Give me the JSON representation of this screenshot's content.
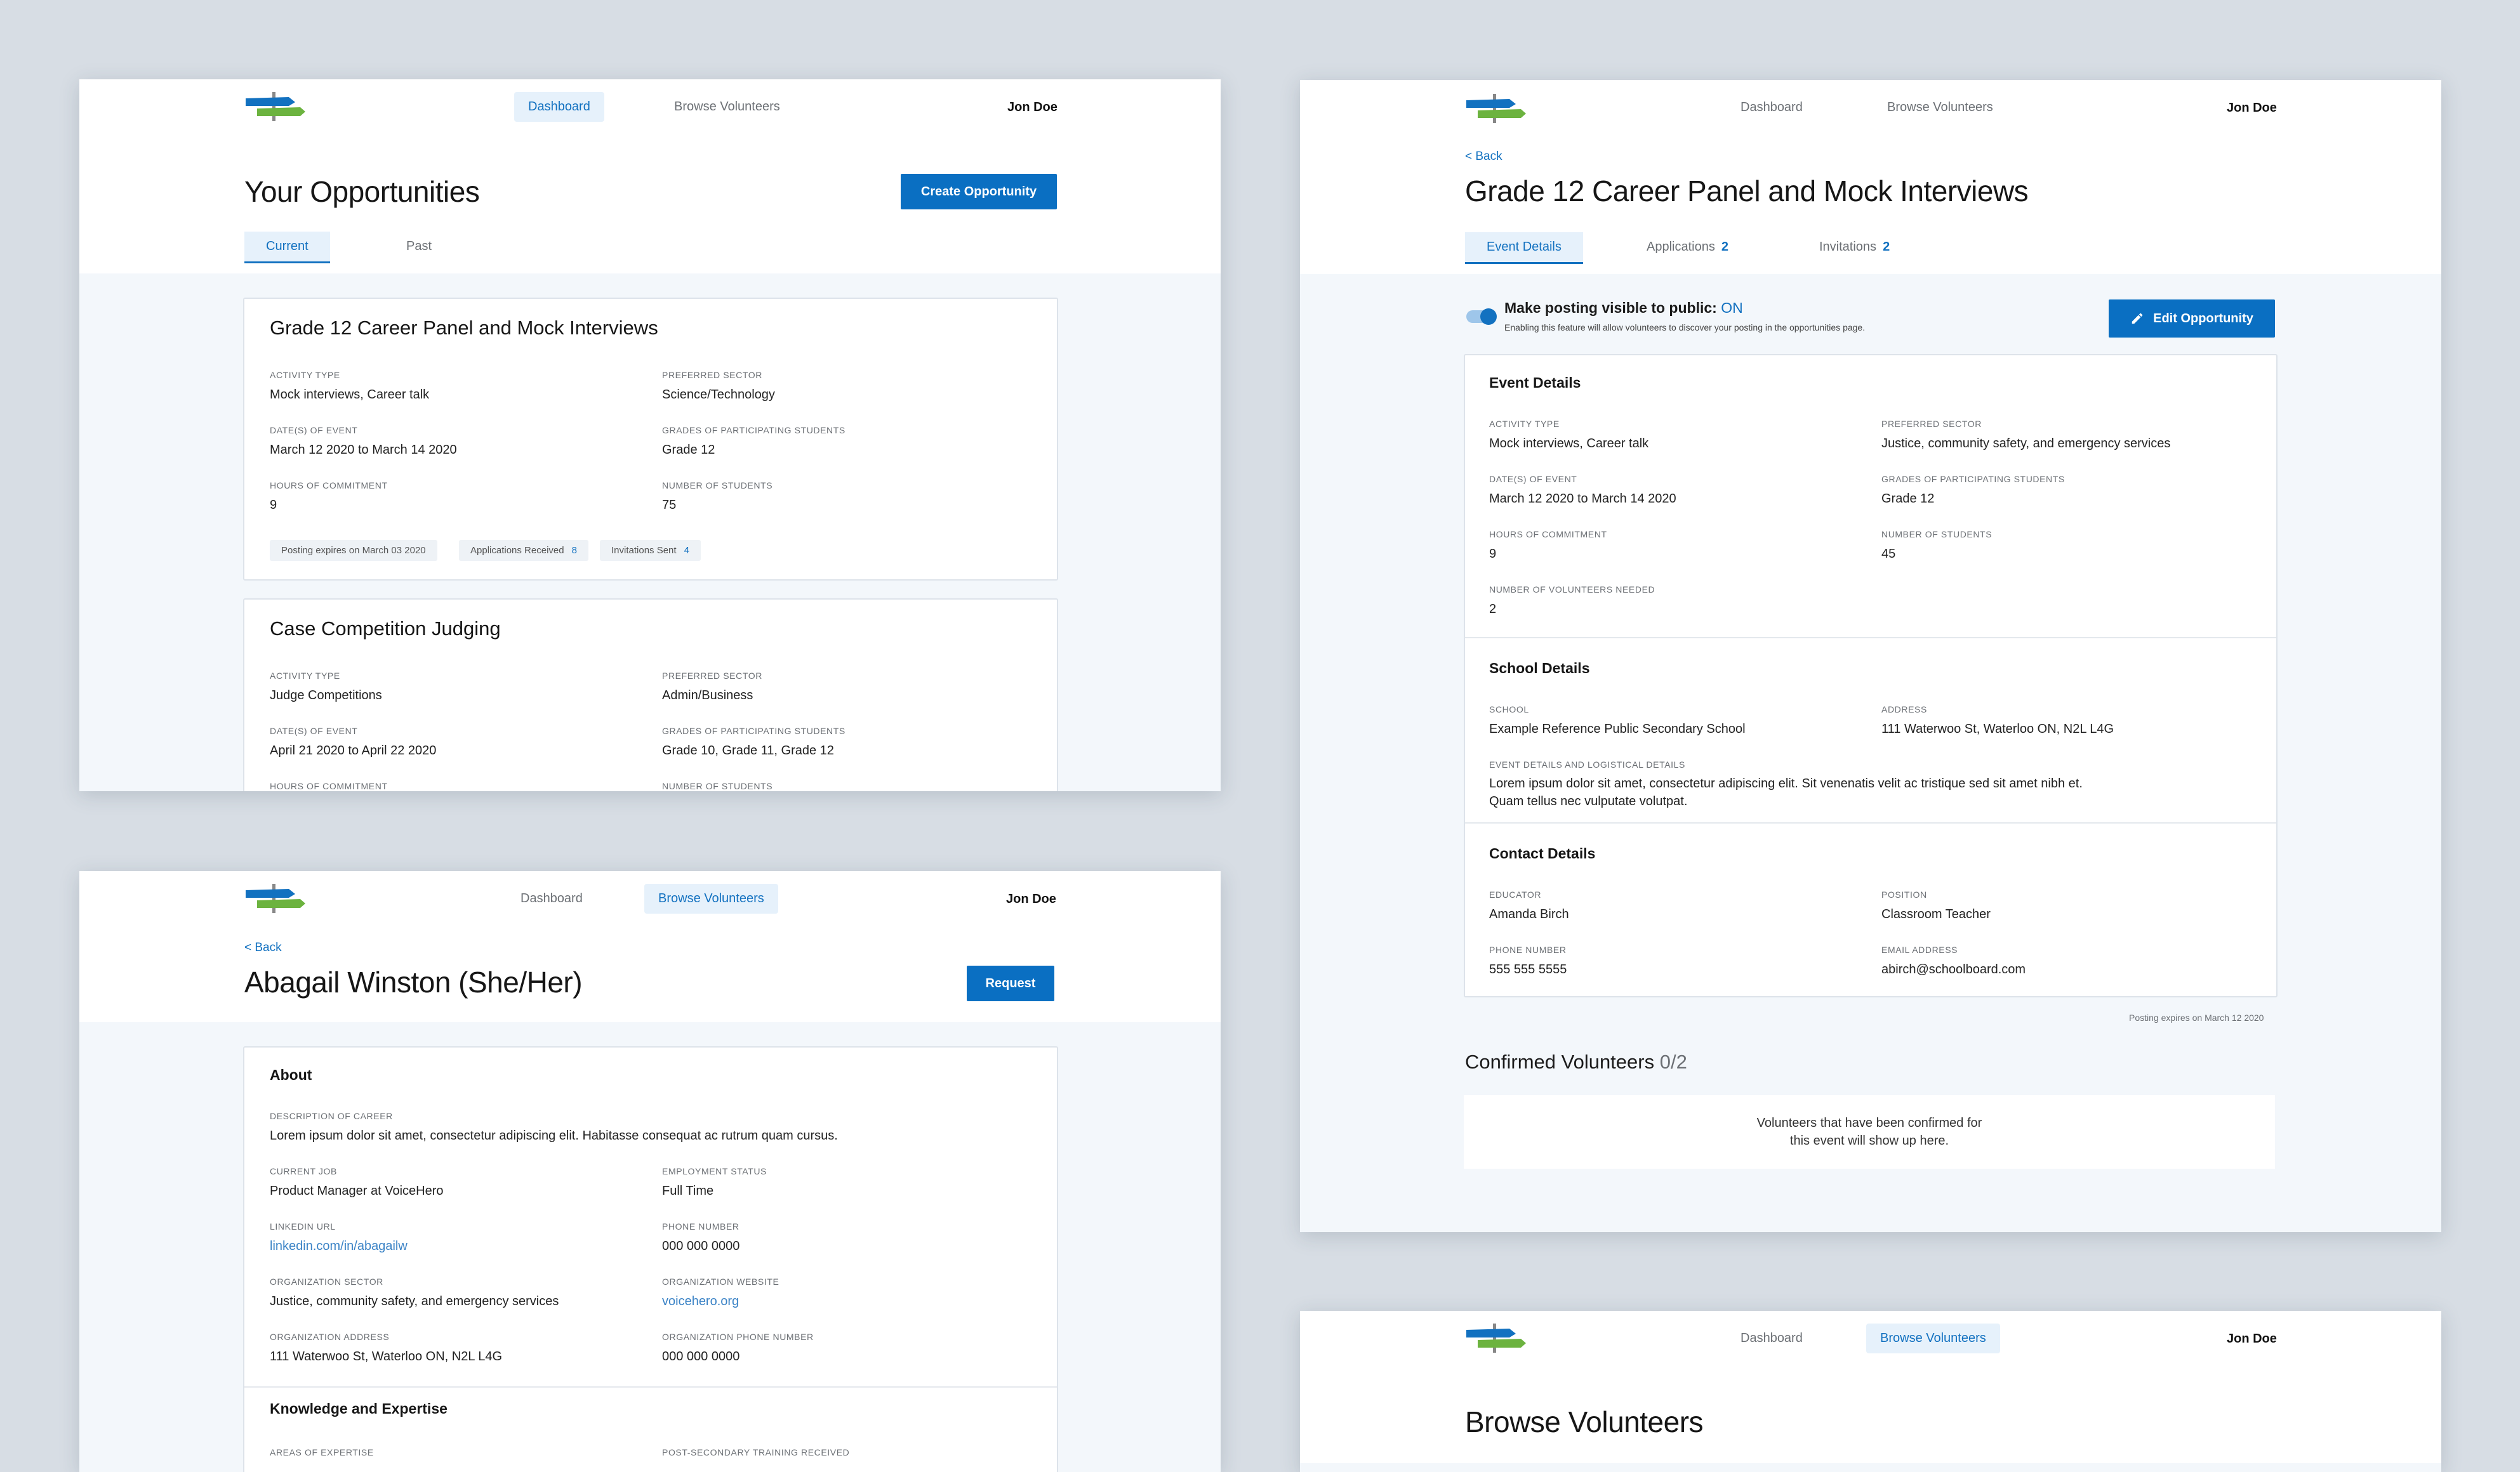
{
  "colors": {
    "brand_blue": "#0a6fc2",
    "link": "#1271c0",
    "bg": "#d7dde4",
    "panel": "#f3f7fb"
  },
  "nav": {
    "dashboard": "Dashboard",
    "browse": "Browse Volunteers",
    "user": "Jon Doe"
  },
  "s1": {
    "title": "Your Opportunities",
    "create_btn": "Create Opportunity",
    "tabs": [
      "Current",
      "Past"
    ],
    "card1": {
      "title": "Grade 12 Career Panel and Mock Interviews",
      "activity_label": "Activity Type",
      "activity": "Mock interviews, Career talk",
      "sector_label": "Preferred Sector",
      "sector": "Science/Technology",
      "dates_label": "Date(s) of Event",
      "dates": "March 12 2020 to March 14 2020",
      "grades_label": "Grades of Participating Students",
      "grades": "Grade 12",
      "hours_label": "Hours of Commitment",
      "hours": "9",
      "students_label": "Number of Students",
      "students": "75",
      "expires": "Posting expires on March 03 2020",
      "apps_label": "Applications Received",
      "apps": "8",
      "inv_label": "Invitations Sent",
      "inv": "4"
    },
    "card2": {
      "title": "Case Competition Judging",
      "activity_label": "Activity Type",
      "activity": "Judge Competitions",
      "sector_label": "Preferred Sector",
      "sector": "Admin/Business",
      "dates_label": "Date(s) of Event",
      "dates": "April 21 2020 to April 22 2020",
      "grades_label": "Grades of Participating Students",
      "grades": "Grade 10, Grade 11, Grade 12",
      "hours_label": "Hours of Commitment",
      "students_label": "Number of Students"
    }
  },
  "s2": {
    "back": "< Back",
    "title": "Abagail Winston (She/Her)",
    "request_btn": "Request",
    "about": "About",
    "career_label": "Description of Career",
    "career": "Lorem ipsum dolor sit amet, consectetur adipiscing elit. Habitasse consequat ac rutrum quam cursus.",
    "job_label": "Current Job",
    "job": "Product Manager at VoiceHero",
    "emp_label": "Employment Status",
    "emp": "Full Time",
    "linkedin_label": "LinkedIn URL",
    "linkedin": "linkedin.com/in/abagailw",
    "phone_label": "Phone Number",
    "phone": "000 000 0000",
    "org_sector_label": "Organization Sector",
    "org_sector": "Justice, community safety, and emergency services",
    "org_web_label": "Organization Website",
    "org_web": "voicehero.org",
    "org_addr_label": "Organization Address",
    "org_addr": "111 Waterwoo St, Waterloo ON, N2L L4G",
    "org_phone_label": "Organization Phone Number",
    "org_phone": "000 000 0000",
    "knowledge": "Knowledge and Expertise",
    "areas_label": "Areas of Expertise",
    "training_label": "Post-Secondary Training Received"
  },
  "s3": {
    "back": "< Back",
    "title": "Grade 12 Career Panel and Mock Interviews",
    "tabs": {
      "event": "Event Details",
      "apps": "Applications",
      "apps_n": "2",
      "inv": "Invitations",
      "inv_n": "2"
    },
    "toggle_label": "Make posting visible to public:",
    "toggle_state": "ON",
    "toggle_help": "Enabling this feature will allow volunteers to discover your posting in the opportunities page.",
    "edit_btn": "Edit Opportunity",
    "event_details": "Event Details",
    "activity_label": "Activity Type",
    "activity": "Mock interviews, Career talk",
    "sector_label": "Preferred Sector",
    "sector": "Justice, community safety, and emergency services",
    "dates_label": "Date(s) of Event",
    "dates": "March 12 2020 to March 14 2020",
    "grades_label": "Grades of Participating Students",
    "grades": "Grade 12",
    "hours_label": "Hours of Commitment",
    "hours": "9",
    "students_label": "Number of Students",
    "students": "45",
    "vol_needed_label": "Number of Volunteers Needed",
    "vol_needed": "2",
    "school_details": "School Details",
    "school_label": "School",
    "school": "Example Reference Public Secondary School",
    "address_label": "Address",
    "address": "111 Waterwoo St, Waterloo ON, N2L L4G",
    "logistics_label": "Event Details and Logistical Details",
    "logistics_1": "Lorem ipsum dolor sit amet, consectetur adipiscing elit. Sit venenatis velit ac tristique sed sit amet nibh et.",
    "logistics_2": "Quam tellus nec vulputate volutpat.",
    "contact_details": "Contact Details",
    "educator_label": "Educator",
    "educator": "Amanda Birch",
    "position_label": "Position",
    "position": "Classroom Teacher",
    "phone_label": "Phone Number",
    "phone": "555 555 5555",
    "email_label": "Email Address",
    "email": "abirch@schoolboard.com",
    "expires": "Posting expires on March 12 2020",
    "confirmed_title": "Confirmed Volunteers",
    "confirmed_count": "0/2",
    "empty_1": "Volunteers that have been confirmed for",
    "empty_2": "this event will show up here."
  },
  "s4": {
    "title": "Browse Volunteers"
  }
}
